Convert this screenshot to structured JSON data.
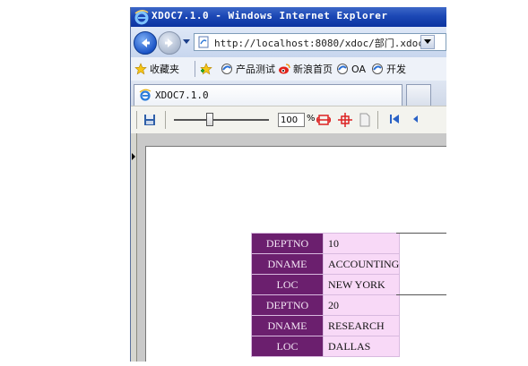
{
  "window": {
    "title": "XDOC7.1.0 - Windows Internet Explorer"
  },
  "address_bar": {
    "url": "http://localhost:8080/xdoc/部门.xdoc"
  },
  "favorites_bar": {
    "favorites_label": "收藏夹",
    "links": [
      {
        "label": "产品测试",
        "icon": "ie-page-icon"
      },
      {
        "label": "新浪首页",
        "icon": "sina-icon"
      },
      {
        "label": "OA",
        "icon": "ie-page-icon"
      },
      {
        "label": "开发",
        "icon": "ie-page-icon"
      }
    ]
  },
  "tabs": {
    "active_label": "XDOC7.1.0"
  },
  "viewer_toolbar": {
    "zoom_value": "100",
    "zoom_unit": "%",
    "zoom_level_fraction": 0.38,
    "icons": [
      "save-icon",
      "fit-width-icon",
      "fit-page-icon",
      "page-icon",
      "first-page-icon",
      "previous-page-icon"
    ]
  },
  "colors": {
    "label_cell_bg": "#6b1f6e",
    "value_cell_bg": "#f8d9f7",
    "title_bar": "#1c48b5"
  },
  "report": {
    "records": [
      {
        "fields": [
          {
            "label": "DEPTNO",
            "value": "10"
          },
          {
            "label": "DNAME",
            "value": "ACCOUNTING"
          },
          {
            "label": "LOC",
            "value": "NEW YORK"
          }
        ]
      },
      {
        "fields": [
          {
            "label": "DEPTNO",
            "value": "20"
          },
          {
            "label": "DNAME",
            "value": "RESEARCH"
          },
          {
            "label": "LOC",
            "value": "DALLAS"
          }
        ]
      }
    ]
  }
}
